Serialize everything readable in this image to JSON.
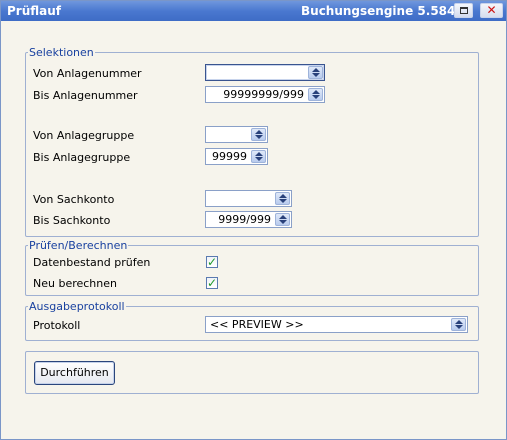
{
  "window": {
    "title_left": "Prüflauf",
    "title_right": "Buchungsengine 5.584",
    "restore_label": "",
    "close_label": "✕"
  },
  "selektionen": {
    "legend": "Selektionen",
    "von_anlagenummer": {
      "label": "Von Anlagenummer",
      "value": ""
    },
    "bis_anlagenummer": {
      "label": "Bis Anlagenummer",
      "value": "99999999/999"
    },
    "von_anlagegruppe": {
      "label": "Von Anlagegruppe",
      "value": ""
    },
    "bis_anlagegruppe": {
      "label": "Bis Anlagegruppe",
      "value": "99999"
    },
    "von_sachkonto": {
      "label": "Von Sachkonto",
      "value": ""
    },
    "bis_sachkonto": {
      "label": "Bis Sachkonto",
      "value": "9999/999"
    }
  },
  "pruefen": {
    "legend": "Prüfen/Berechnen",
    "datenbestand": {
      "label": "Datenbestand prüfen",
      "checked": true,
      "mark": "✓"
    },
    "neu_berechnen": {
      "label": "Neu berechnen",
      "checked": true,
      "mark": "✓"
    }
  },
  "ausgabe": {
    "legend": "Ausgabeprotokoll",
    "protokoll": {
      "label": "Protokoll",
      "value": "<< PREVIEW >>"
    }
  },
  "actions": {
    "run_label": "Durchführen"
  },
  "icons": {
    "spin": "spin-updown-icon",
    "check": "checkmark-icon",
    "restore": "restore-icon",
    "close": "close-icon"
  },
  "colors": {
    "titlebar": "#4a78d0",
    "legend": "#1a42a0",
    "check": "#1f9a2a",
    "background": "#f6f4ec"
  }
}
